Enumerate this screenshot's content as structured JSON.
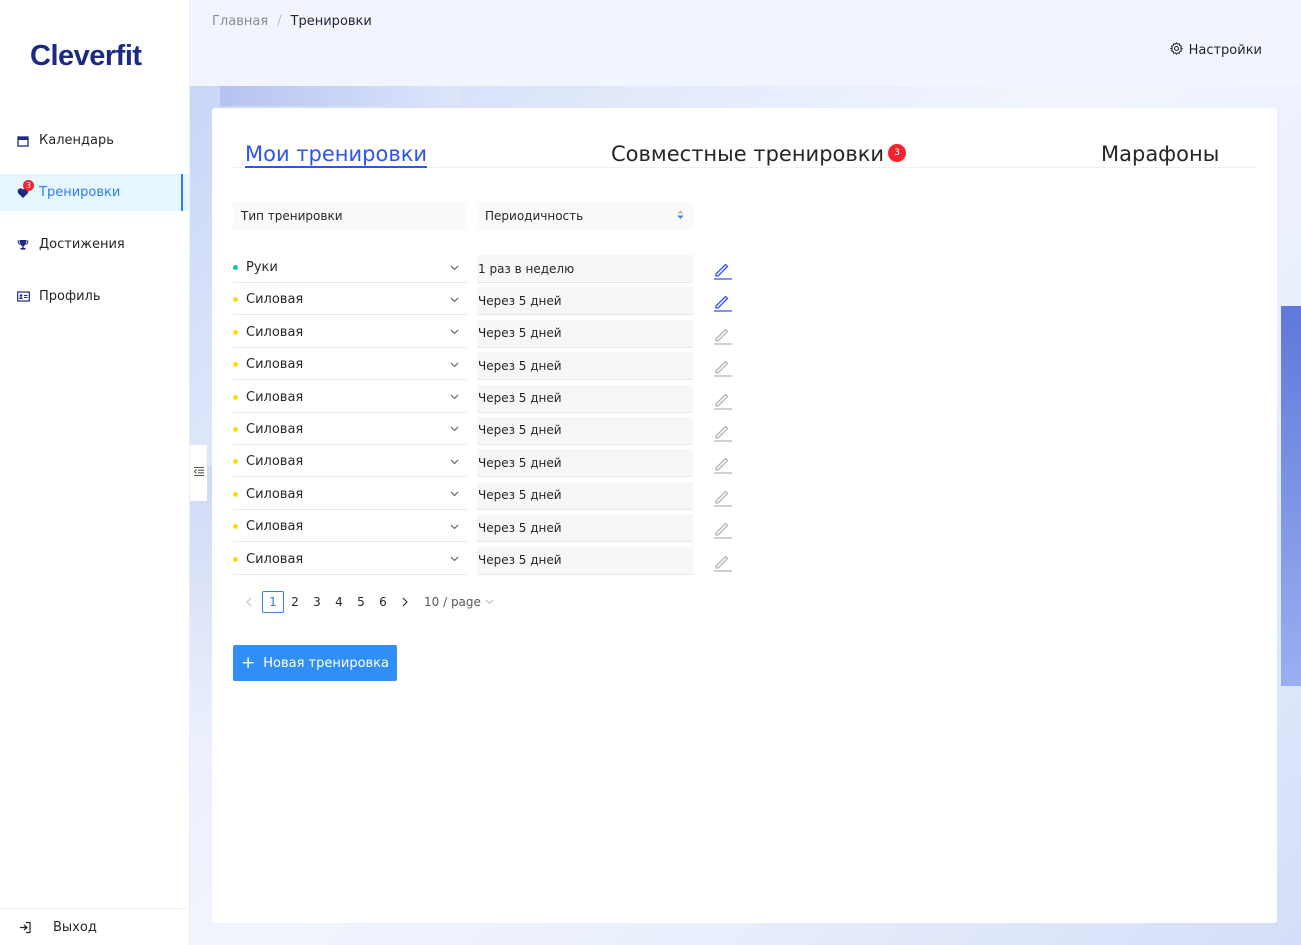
{
  "logo": "Cleverfit",
  "sidebar": {
    "items": [
      {
        "label": "Календарь",
        "icon": "calendar-icon"
      },
      {
        "label": "Тренировки",
        "icon": "heart-icon",
        "badge": "3",
        "active": true
      },
      {
        "label": "Достижения",
        "icon": "trophy-icon"
      },
      {
        "label": "Профиль",
        "icon": "id-card-icon"
      }
    ],
    "exit_label": "Выход"
  },
  "header": {
    "breadcrumb": [
      "Главная",
      "Тренировки"
    ],
    "breadcrumb_sep": "/",
    "settings_label": "Настройки"
  },
  "tabs": [
    {
      "label": "Мои тренировки",
      "active": true
    },
    {
      "label": "Совместные тренировки",
      "badge": "3"
    },
    {
      "label": "Марафоны"
    }
  ],
  "columns": {
    "type": "Тип тренировки",
    "period": "Периодичность"
  },
  "colors": {
    "dot_teal": "#13c2c2",
    "dot_yellow": "#fadb14",
    "accent": "#2f54eb",
    "button": "#2f8ff7"
  },
  "rows": [
    {
      "type": "Руки",
      "period": "1 раз в неделю",
      "dot": "teal",
      "edit_active": true
    },
    {
      "type": "Силовая",
      "period": "Через 5 дней",
      "dot": "yellow",
      "edit_active": true
    },
    {
      "type": "Силовая",
      "period": "Через 5 дней",
      "dot": "yellow",
      "edit_active": false
    },
    {
      "type": "Силовая",
      "period": "Через 5 дней",
      "dot": "yellow",
      "edit_active": false
    },
    {
      "type": "Силовая",
      "period": "Через 5 дней",
      "dot": "yellow",
      "edit_active": false
    },
    {
      "type": "Силовая",
      "period": "Через 5 дней",
      "dot": "yellow",
      "edit_active": false
    },
    {
      "type": "Силовая",
      "period": "Через 5 дней",
      "dot": "yellow",
      "edit_active": false
    },
    {
      "type": "Силовая",
      "period": "Через 5 дней",
      "dot": "yellow",
      "edit_active": false
    },
    {
      "type": "Силовая",
      "period": "Через 5 дней",
      "dot": "yellow",
      "edit_active": false
    },
    {
      "type": "Силовая",
      "period": "Через 5 дней",
      "dot": "yellow",
      "edit_active": false
    }
  ],
  "pagination": {
    "pages": [
      "1",
      "2",
      "3",
      "4",
      "5",
      "6"
    ],
    "current": "1",
    "page_size": "10 / page"
  },
  "new_button": "Новая тренировка"
}
